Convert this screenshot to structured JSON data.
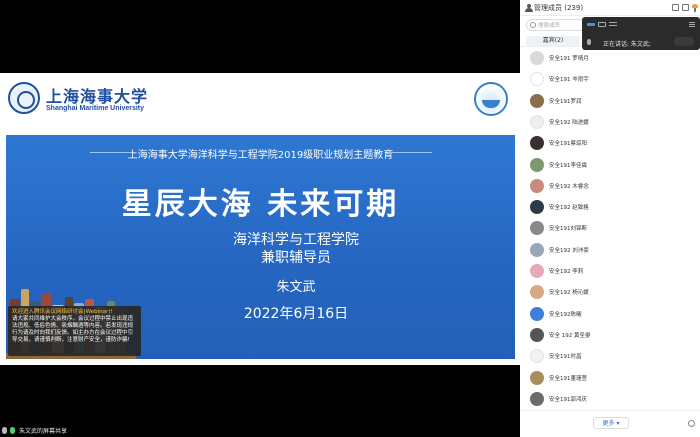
{
  "slide": {
    "univ_cn": "上海海事大学",
    "univ_en": "Shanghai Maritime University",
    "subtitle": "上海海事大学海洋科学与工程学院2019级职业规划主题教育",
    "main_title": "星辰大海   未来可期",
    "school": "海洋科学与工程学院",
    "role": "兼职辅导员",
    "person": "朱文武",
    "date": "2022年6月16日"
  },
  "notice": {
    "title": "欢迎进入腾讯会议网络研讨会(Webinar)!",
    "text": "请大家共同维护大会秩序。会议过程中禁止出现违法违规、低俗色情、吸烟酗酒等内容。若发现违规行为请及时向我们反馈。如主办方在会议过程中引导交易，请谨慎判断，注意财产安全，谨防诈骗!"
  },
  "bottom": {
    "sharer_label": "朱文武的屏幕共享"
  },
  "panel": {
    "title": "管理成员 (239)",
    "search_placeholder": "搜索成员",
    "tab_unmuted": "嘉宾(2)",
    "more_label": "更多 ▾",
    "speaking": "正在讲话: 朱文武;",
    "members": [
      {
        "name": "安全191 罗晴月",
        "color": "#d9d9d9"
      },
      {
        "name": "安全191 岑雨宇",
        "color": "#ffffff"
      },
      {
        "name": "安全191罗润",
        "color": "#8b6d4a"
      },
      {
        "name": "安全192 陆进媛",
        "color": "#efefef"
      },
      {
        "name": "安全191蔡琼阳",
        "color": "#3b3030"
      },
      {
        "name": "安全191李佳霖",
        "color": "#7c9a6a"
      },
      {
        "name": "安全192 木睿念",
        "color": "#c98a7a"
      },
      {
        "name": "安全192 赵致格",
        "color": "#2e3a4a"
      },
      {
        "name": "安全191刘锦斯",
        "color": "#8a8a8a"
      },
      {
        "name": "安全192 刘沛豪",
        "color": "#9aa7b8"
      },
      {
        "name": "安全192 李莉",
        "color": "#e7a9b7"
      },
      {
        "name": "安全192 杨沁媛",
        "color": "#d9a880"
      },
      {
        "name": "安全192陈曦",
        "color": "#3f7fd9"
      },
      {
        "name": "安全 192 黄圣晏",
        "color": "#555555"
      },
      {
        "name": "安全191时昌",
        "color": "#f2f2f2"
      },
      {
        "name": "安全191董瑾萱",
        "color": "#a88c5a"
      },
      {
        "name": "安全191郭鸿庆",
        "color": "#6b6b6b"
      }
    ]
  }
}
